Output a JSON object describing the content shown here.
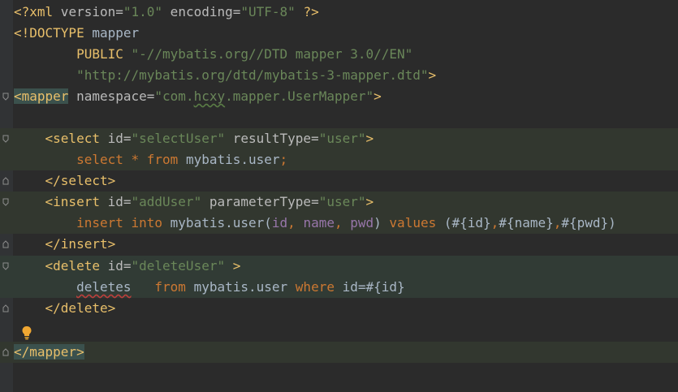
{
  "editor": {
    "language": "xml",
    "colors": {
      "background": "#2b2b2b",
      "gutter": "#313335",
      "highlight": "#32372f",
      "tag": "#e8bf6a",
      "attribute": "#bababa",
      "value": "#6a8759",
      "keyword": "#cc7832",
      "param": "#9876aa"
    },
    "lines": [
      {
        "segments": [
          [
            "t-tag",
            "<?xml"
          ],
          [
            "t-attr",
            " version="
          ],
          [
            "t-val",
            "\"1.0\""
          ],
          [
            "t-attr",
            " encoding="
          ],
          [
            "t-val",
            "\"UTF-8\""
          ],
          [
            "t-tag",
            " ?>"
          ]
        ]
      },
      {
        "segments": [
          [
            "t-tag",
            "<!DOCTYPE"
          ],
          [
            "t-txt",
            " mapper"
          ]
        ]
      },
      {
        "segments": [
          [
            "t-txt",
            "        "
          ],
          [
            "t-tag",
            "PUBLIC"
          ],
          [
            "t-txt",
            " "
          ],
          [
            "t-val",
            "\"-//mybatis.org//DTD mapper 3.0//EN\""
          ]
        ]
      },
      {
        "segments": [
          [
            "t-txt",
            "        "
          ],
          [
            "t-val",
            "\"http://mybatis.org/dtd/mybatis-3-mapper.dtd\""
          ],
          [
            "t-tag",
            ">"
          ]
        ]
      },
      {
        "segments": [
          [
            "t-tagbg",
            "<mapper"
          ],
          [
            "t-attr",
            " namespace="
          ],
          [
            "t-val",
            "\"com."
          ],
          [
            "t-val t-typo",
            "hcxy"
          ],
          [
            "t-val",
            ".mapper.UserMapper\""
          ],
          [
            "t-tag",
            ">"
          ]
        ]
      },
      {
        "segments": []
      },
      {
        "segments": [
          [
            "t-txt",
            "    "
          ],
          [
            "t-tag",
            "<select"
          ],
          [
            "t-attr",
            " id="
          ],
          [
            "t-val",
            "\"selectUser\""
          ],
          [
            "t-attr",
            " resultType="
          ],
          [
            "t-val",
            "\"user\""
          ],
          [
            "t-tag",
            ">"
          ]
        ]
      },
      {
        "segments": [
          [
            "t-txt",
            "        "
          ],
          [
            "t-kw",
            "select"
          ],
          [
            "t-sql",
            " "
          ],
          [
            "t-kw",
            "*"
          ],
          [
            "t-sql",
            " "
          ],
          [
            "t-kw",
            "from"
          ],
          [
            "t-sql",
            " mybatis.user"
          ],
          [
            "t-kw",
            ";"
          ]
        ]
      },
      {
        "segments": [
          [
            "t-txt",
            "    "
          ],
          [
            "t-tag",
            "</select>"
          ]
        ]
      },
      {
        "segments": [
          [
            "t-txt",
            "    "
          ],
          [
            "t-tag",
            "<insert"
          ],
          [
            "t-attr",
            " id="
          ],
          [
            "t-val",
            "\"addUser\""
          ],
          [
            "t-attr",
            " parameterType="
          ],
          [
            "t-val",
            "\"user\""
          ],
          [
            "t-tag",
            ">"
          ]
        ]
      },
      {
        "segments": [
          [
            "t-txt",
            "        "
          ],
          [
            "t-kw",
            "insert"
          ],
          [
            "t-sql",
            " "
          ],
          [
            "t-kw",
            "into"
          ],
          [
            "t-sql",
            " mybatis.user("
          ],
          [
            "t-par",
            "id"
          ],
          [
            "t-kw",
            ","
          ],
          [
            "t-sql",
            " "
          ],
          [
            "t-par",
            "name"
          ],
          [
            "t-kw",
            ","
          ],
          [
            "t-sql",
            " "
          ],
          [
            "t-par",
            "pwd"
          ],
          [
            "t-sql",
            ") "
          ],
          [
            "t-kw",
            "values"
          ],
          [
            "t-sql",
            " (#{id}"
          ],
          [
            "t-kw",
            ","
          ],
          [
            "t-sql",
            "#{name}"
          ],
          [
            "t-kw",
            ","
          ],
          [
            "t-sql",
            "#{pwd})"
          ]
        ]
      },
      {
        "segments": [
          [
            "t-txt",
            "    "
          ],
          [
            "t-tag",
            "</insert>"
          ]
        ]
      },
      {
        "segments": [
          [
            "t-txt",
            "    "
          ],
          [
            "t-tag",
            "<delete"
          ],
          [
            "t-attr",
            " id="
          ],
          [
            "t-val",
            "\"deleteUser\""
          ],
          [
            "t-tag",
            " >"
          ]
        ]
      },
      {
        "segments": [
          [
            "t-txt",
            "        "
          ],
          [
            "t-sql t-err",
            "deletes"
          ],
          [
            "t-sql",
            "   "
          ],
          [
            "t-kw",
            "from"
          ],
          [
            "t-sql",
            " mybatis.user "
          ],
          [
            "t-kw",
            "where"
          ],
          [
            "t-sql",
            " id=#{id}"
          ]
        ]
      },
      {
        "segments": [
          [
            "t-txt",
            "    "
          ],
          [
            "t-tag",
            "</delete>"
          ]
        ]
      },
      {
        "segments": []
      },
      {
        "segments": [
          [
            "t-tagbg",
            "</mapper>"
          ]
        ]
      }
    ]
  }
}
